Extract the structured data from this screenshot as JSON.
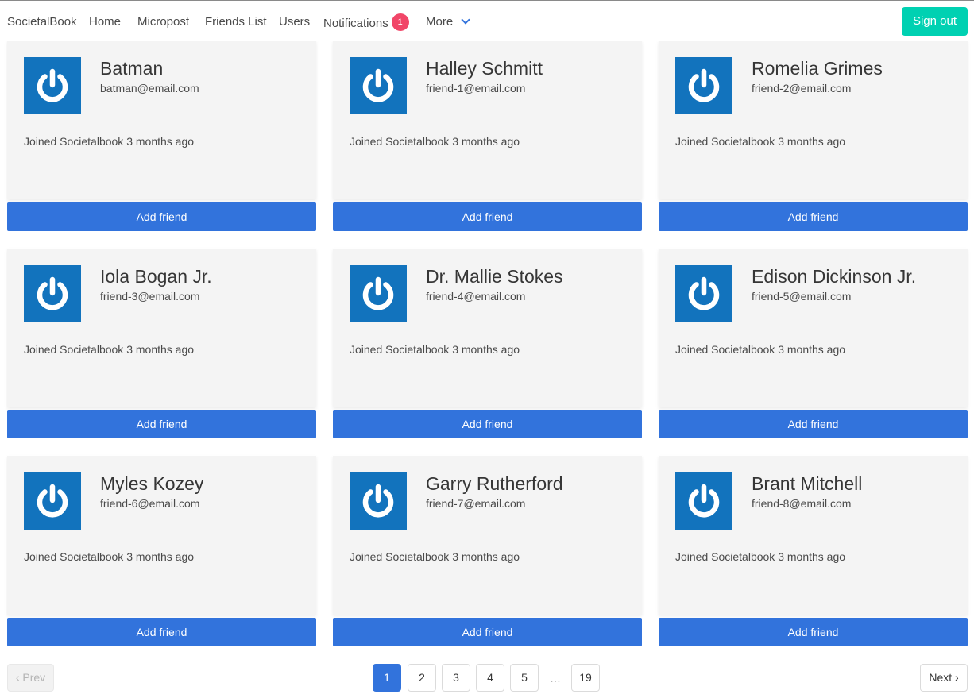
{
  "nav": {
    "brand": "SocietalBook",
    "items": [
      "Home",
      "Micropost",
      "Friends List",
      "Users"
    ],
    "notifications_label": "Notifications",
    "notifications_count": "1",
    "more_label": "More",
    "signout_label": "Sign out"
  },
  "users": [
    {
      "name": "Batman",
      "email": "batman@email.com",
      "joined": "Joined Societalbook 3 months ago",
      "action": "Add friend"
    },
    {
      "name": "Halley Schmitt",
      "email": "friend-1@email.com",
      "joined": "Joined Societalbook 3 months ago",
      "action": "Add friend"
    },
    {
      "name": "Romelia Grimes",
      "email": "friend-2@email.com",
      "joined": "Joined Societalbook 3 months ago",
      "action": "Add friend"
    },
    {
      "name": "Iola Bogan Jr.",
      "email": "friend-3@email.com",
      "joined": "Joined Societalbook 3 months ago",
      "action": "Add friend"
    },
    {
      "name": "Dr. Mallie Stokes",
      "email": "friend-4@email.com",
      "joined": "Joined Societalbook 3 months ago",
      "action": "Add friend"
    },
    {
      "name": "Edison Dickinson Jr.",
      "email": "friend-5@email.com",
      "joined": "Joined Societalbook 3 months ago",
      "action": "Add friend"
    },
    {
      "name": "Myles Kozey",
      "email": "friend-6@email.com",
      "joined": "Joined Societalbook 3 months ago",
      "action": "Add friend"
    },
    {
      "name": "Garry Rutherford",
      "email": "friend-7@email.com",
      "joined": "Joined Societalbook 3 months ago",
      "action": "Add friend"
    },
    {
      "name": "Brant Mitchell",
      "email": "friend-8@email.com",
      "joined": "Joined Societalbook 3 months ago",
      "action": "Add friend"
    }
  ],
  "pagination": {
    "prev_label": "‹ Prev",
    "next_label": "Next ›",
    "pages": [
      "1",
      "2",
      "3",
      "4",
      "5"
    ],
    "ellipsis": "…",
    "last_page": "19",
    "current": "1"
  },
  "colors": {
    "primary": "#3273dc",
    "signout": "#00d1b2",
    "badge": "#f14668",
    "avatar_bg": "#1273bd"
  },
  "icons": {
    "avatar": "power-icon"
  }
}
